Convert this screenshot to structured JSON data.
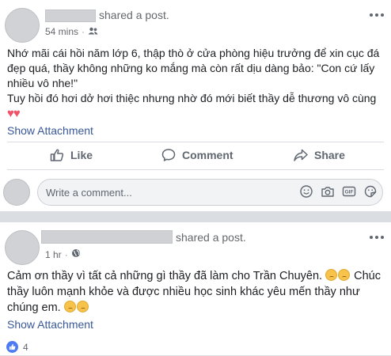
{
  "post1": {
    "author_obscured": true,
    "shared_label": "shared a post.",
    "time": "54 mins",
    "audience_icon": "friends-icon",
    "text_line1": "Nhớ mãi cái hồi năm lớp 6, thập thò ở cửa phòng hiệu trưởng để xin cục đá đẹp quá, thầy không những ko mắng mà còn rất dịu dàng bảo: \"Con cứ lấy nhiều vô nhe!\"",
    "text_line2": "Tuy hồi đó hơi dở hơi thiệc nhưng nhờ đó mới biết thầy dễ thương vô cùng",
    "hearts": "♥♥",
    "show_attachment": "Show Attachment",
    "actions": {
      "like": "Like",
      "comment": "Comment",
      "share": "Share"
    }
  },
  "comment_input": {
    "placeholder": "Write a comment...",
    "icons": [
      "emoji-icon",
      "camera-icon",
      "gif-icon",
      "sticker-icon"
    ]
  },
  "post2": {
    "author_obscured": true,
    "shared_label": "shared a post.",
    "time": "1 hr",
    "audience_icon": "globe-icon",
    "text_part1": "Cảm ơn thầy vì tất cả những gì thầy đã làm cho Trần Chuyên. ",
    "text_part2": " Chúc thầy luôn mạnh khỏe và được nhiều học sinh khác yêu mến thầy như chúng em. ",
    "show_attachment": "Show Attachment",
    "like_count": "4"
  },
  "colors": {
    "link": "#385898",
    "muted": "#606770",
    "heart": "#f25268",
    "like_blue": "#4c7bf3"
  }
}
